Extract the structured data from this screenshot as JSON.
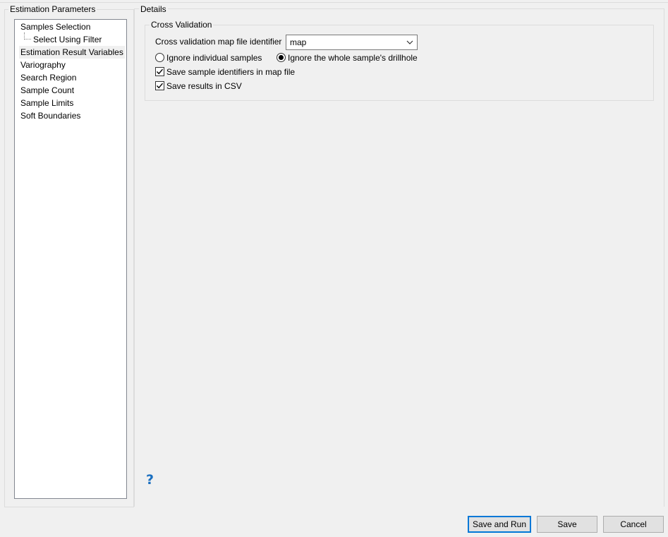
{
  "left_panel": {
    "title": "Estimation Parameters",
    "items": [
      {
        "label": "Samples Selection"
      },
      {
        "label": "Select Using Filter"
      },
      {
        "label": "Estimation Result Variables"
      },
      {
        "label": "Variography"
      },
      {
        "label": "Search Region"
      },
      {
        "label": "Sample Count"
      },
      {
        "label": "Sample Limits"
      },
      {
        "label": "Soft Boundaries"
      }
    ],
    "selected_item": "Estimation Result Variables"
  },
  "details": {
    "title": "Details",
    "cross_validation": {
      "title": "Cross Validation",
      "map_file_label": "Cross validation map file identifier",
      "map_file_value": "map",
      "radio_options": [
        {
          "label": "Ignore individual samples",
          "selected": false
        },
        {
          "label": "Ignore the whole sample's drillhole",
          "selected": true
        }
      ],
      "checkboxes": [
        {
          "label": "Save sample identifiers in map file",
          "checked": true
        },
        {
          "label": "Save results in CSV",
          "checked": true
        }
      ]
    },
    "help_icon": "help-question-icon"
  },
  "buttons": {
    "save_and_run": "Save and Run",
    "save": "Save",
    "cancel": "Cancel"
  },
  "colors": {
    "background": "#f0f0f0",
    "accent": "#0078d7",
    "help": "#1a6fc0"
  }
}
